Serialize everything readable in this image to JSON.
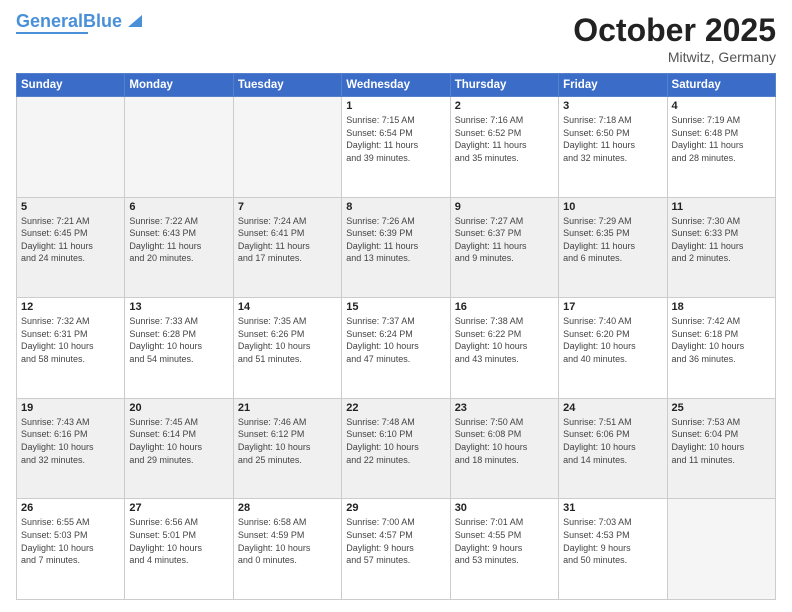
{
  "header": {
    "logo_line1": "General",
    "logo_line2": "Blue",
    "month": "October 2025",
    "location": "Mitwitz, Germany"
  },
  "days_of_week": [
    "Sunday",
    "Monday",
    "Tuesday",
    "Wednesday",
    "Thursday",
    "Friday",
    "Saturday"
  ],
  "weeks": [
    {
      "shaded": false,
      "days": [
        {
          "num": "",
          "info": ""
        },
        {
          "num": "",
          "info": ""
        },
        {
          "num": "",
          "info": ""
        },
        {
          "num": "1",
          "info": "Sunrise: 7:15 AM\nSunset: 6:54 PM\nDaylight: 11 hours\nand 39 minutes."
        },
        {
          "num": "2",
          "info": "Sunrise: 7:16 AM\nSunset: 6:52 PM\nDaylight: 11 hours\nand 35 minutes."
        },
        {
          "num": "3",
          "info": "Sunrise: 7:18 AM\nSunset: 6:50 PM\nDaylight: 11 hours\nand 32 minutes."
        },
        {
          "num": "4",
          "info": "Sunrise: 7:19 AM\nSunset: 6:48 PM\nDaylight: 11 hours\nand 28 minutes."
        }
      ]
    },
    {
      "shaded": true,
      "days": [
        {
          "num": "5",
          "info": "Sunrise: 7:21 AM\nSunset: 6:45 PM\nDaylight: 11 hours\nand 24 minutes."
        },
        {
          "num": "6",
          "info": "Sunrise: 7:22 AM\nSunset: 6:43 PM\nDaylight: 11 hours\nand 20 minutes."
        },
        {
          "num": "7",
          "info": "Sunrise: 7:24 AM\nSunset: 6:41 PM\nDaylight: 11 hours\nand 17 minutes."
        },
        {
          "num": "8",
          "info": "Sunrise: 7:26 AM\nSunset: 6:39 PM\nDaylight: 11 hours\nand 13 minutes."
        },
        {
          "num": "9",
          "info": "Sunrise: 7:27 AM\nSunset: 6:37 PM\nDaylight: 11 hours\nand 9 minutes."
        },
        {
          "num": "10",
          "info": "Sunrise: 7:29 AM\nSunset: 6:35 PM\nDaylight: 11 hours\nand 6 minutes."
        },
        {
          "num": "11",
          "info": "Sunrise: 7:30 AM\nSunset: 6:33 PM\nDaylight: 11 hours\nand 2 minutes."
        }
      ]
    },
    {
      "shaded": false,
      "days": [
        {
          "num": "12",
          "info": "Sunrise: 7:32 AM\nSunset: 6:31 PM\nDaylight: 10 hours\nand 58 minutes."
        },
        {
          "num": "13",
          "info": "Sunrise: 7:33 AM\nSunset: 6:28 PM\nDaylight: 10 hours\nand 54 minutes."
        },
        {
          "num": "14",
          "info": "Sunrise: 7:35 AM\nSunset: 6:26 PM\nDaylight: 10 hours\nand 51 minutes."
        },
        {
          "num": "15",
          "info": "Sunrise: 7:37 AM\nSunset: 6:24 PM\nDaylight: 10 hours\nand 47 minutes."
        },
        {
          "num": "16",
          "info": "Sunrise: 7:38 AM\nSunset: 6:22 PM\nDaylight: 10 hours\nand 43 minutes."
        },
        {
          "num": "17",
          "info": "Sunrise: 7:40 AM\nSunset: 6:20 PM\nDaylight: 10 hours\nand 40 minutes."
        },
        {
          "num": "18",
          "info": "Sunrise: 7:42 AM\nSunset: 6:18 PM\nDaylight: 10 hours\nand 36 minutes."
        }
      ]
    },
    {
      "shaded": true,
      "days": [
        {
          "num": "19",
          "info": "Sunrise: 7:43 AM\nSunset: 6:16 PM\nDaylight: 10 hours\nand 32 minutes."
        },
        {
          "num": "20",
          "info": "Sunrise: 7:45 AM\nSunset: 6:14 PM\nDaylight: 10 hours\nand 29 minutes."
        },
        {
          "num": "21",
          "info": "Sunrise: 7:46 AM\nSunset: 6:12 PM\nDaylight: 10 hours\nand 25 minutes."
        },
        {
          "num": "22",
          "info": "Sunrise: 7:48 AM\nSunset: 6:10 PM\nDaylight: 10 hours\nand 22 minutes."
        },
        {
          "num": "23",
          "info": "Sunrise: 7:50 AM\nSunset: 6:08 PM\nDaylight: 10 hours\nand 18 minutes."
        },
        {
          "num": "24",
          "info": "Sunrise: 7:51 AM\nSunset: 6:06 PM\nDaylight: 10 hours\nand 14 minutes."
        },
        {
          "num": "25",
          "info": "Sunrise: 7:53 AM\nSunset: 6:04 PM\nDaylight: 10 hours\nand 11 minutes."
        }
      ]
    },
    {
      "shaded": false,
      "days": [
        {
          "num": "26",
          "info": "Sunrise: 6:55 AM\nSunset: 5:03 PM\nDaylight: 10 hours\nand 7 minutes."
        },
        {
          "num": "27",
          "info": "Sunrise: 6:56 AM\nSunset: 5:01 PM\nDaylight: 10 hours\nand 4 minutes."
        },
        {
          "num": "28",
          "info": "Sunrise: 6:58 AM\nSunset: 4:59 PM\nDaylight: 10 hours\nand 0 minutes."
        },
        {
          "num": "29",
          "info": "Sunrise: 7:00 AM\nSunset: 4:57 PM\nDaylight: 9 hours\nand 57 minutes."
        },
        {
          "num": "30",
          "info": "Sunrise: 7:01 AM\nSunset: 4:55 PM\nDaylight: 9 hours\nand 53 minutes."
        },
        {
          "num": "31",
          "info": "Sunrise: 7:03 AM\nSunset: 4:53 PM\nDaylight: 9 hours\nand 50 minutes."
        },
        {
          "num": "",
          "info": ""
        }
      ]
    }
  ]
}
